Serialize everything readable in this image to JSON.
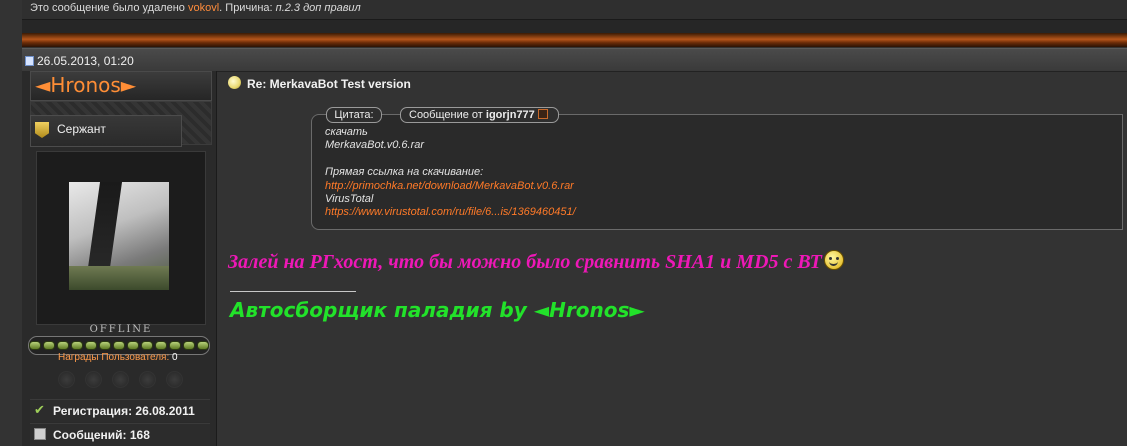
{
  "deleted_notice": {
    "prefix": "Это сообщение было удалено ",
    "user": "vokovl",
    "reason_label": ". Причина: ",
    "reason": "п.2.3 доп правил"
  },
  "post": {
    "date": "26.05.2013, 01:20",
    "title": "Re: MerkavaBot Test version",
    "message": "Залей на РГхост, что бы можно было сравнить SHA1 и MD5 с ВТ",
    "signature": "Автосборщик паладия by ◄Hronos►"
  },
  "author": {
    "username": "◄Hronos►",
    "rank": "Сержант",
    "status": "OFFLINE",
    "awards_label": "Награды Пользователя:",
    "awards_count": "0",
    "registration": "Регистрация: 26.08.2011",
    "posts": "Сообщений: 168"
  },
  "quote": {
    "cite_label": "Цитата:",
    "from_label": "Сообщение от ",
    "from_author": "igorjn777",
    "lines": [
      {
        "text": "скачать",
        "link": false
      },
      {
        "text": "MerkavaBot.v0.6.rar",
        "link": false
      },
      {
        "text": "",
        "link": false
      },
      {
        "text": "Прямая ссылка на скачивание:",
        "link": false
      },
      {
        "text": "http://primochka.net/download/MerkavaBot.v0.6.rar",
        "link": true
      },
      {
        "text": "VirusTotal",
        "link": false
      },
      {
        "text": "https://www.virustotal.com/ru/file/6...is/1369460451/",
        "link": true
      }
    ]
  },
  "colors": {
    "accent_orange": "#ff8e36",
    "link_orange": "#ff7a28",
    "message_magenta": "#ee18b7",
    "signature_green": "#22e22a"
  },
  "icons": {
    "post": "post-page-icon",
    "rank": "rank-chevron-icon",
    "title": "lightbulb-icon",
    "smiley": "smiley-icon",
    "registration": "checkmark-icon",
    "posts": "document-icon"
  }
}
